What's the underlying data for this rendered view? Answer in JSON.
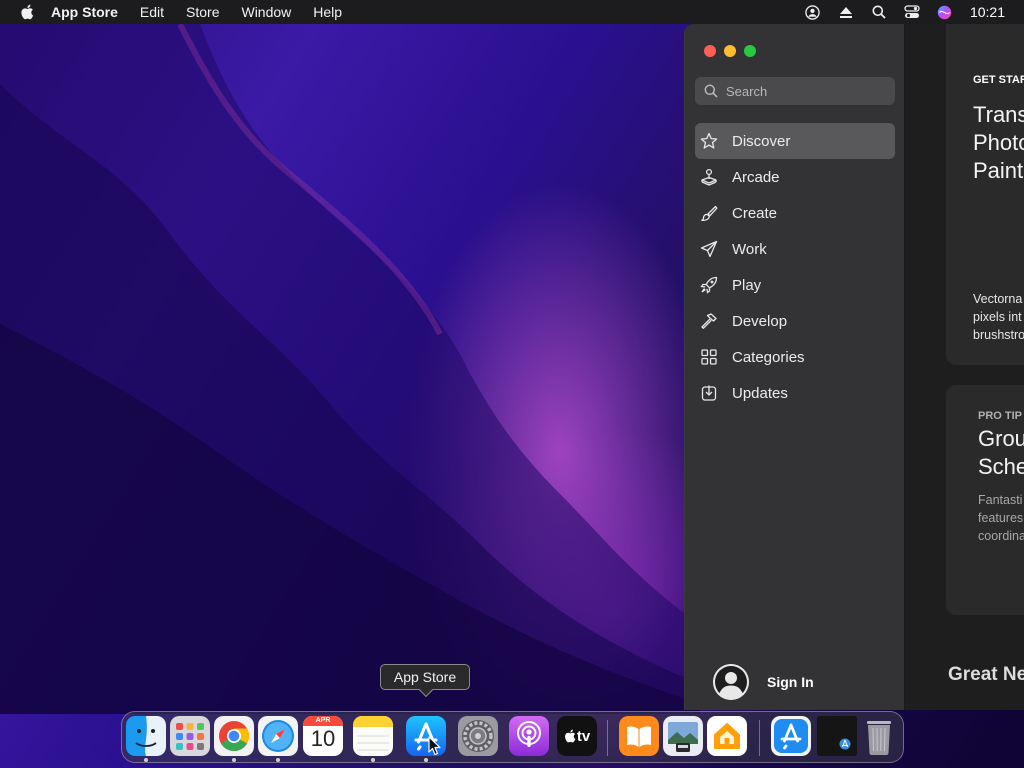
{
  "menubar": {
    "apple_icon": "apple-logo-icon",
    "app_name": "App Store",
    "menus": [
      "Edit",
      "Store",
      "Window",
      "Help"
    ],
    "status_icons": [
      "user-account-icon",
      "eject-icon",
      "spotlight-search-icon",
      "control-center-icon",
      "siri-icon"
    ],
    "clock": "10:21"
  },
  "window": {
    "search": {
      "placeholder": "Search"
    },
    "sidebar_items": [
      {
        "label": "Discover",
        "icon": "star-icon",
        "active": true
      },
      {
        "label": "Arcade",
        "icon": "joystick-icon"
      },
      {
        "label": "Create",
        "icon": "brush-icon"
      },
      {
        "label": "Work",
        "icon": "paper-plane-icon"
      },
      {
        "label": "Play",
        "icon": "rocket-icon"
      },
      {
        "label": "Develop",
        "icon": "hammer-icon"
      },
      {
        "label": "Categories",
        "icon": "grid-icon"
      },
      {
        "label": "Updates",
        "icon": "download-tray-icon"
      }
    ],
    "sign_in": "Sign In",
    "cards": [
      {
        "eyebrow": "GET STAR",
        "headline": "Trans\nPhoto\nPaint",
        "description": "Vectorna\npixels int\nbrushstro"
      },
      {
        "eyebrow": "PRO TIP",
        "headline": "Grou\nSche",
        "description": "Fantasti\nfeatures\ncoordina"
      }
    ],
    "section_title": "Great Ne"
  },
  "tooltip": "App Store",
  "dock": {
    "apps": [
      {
        "name": "finder-icon",
        "running": true
      },
      {
        "name": "launchpad-icon",
        "running": false
      },
      {
        "name": "chrome-icon",
        "running": true
      },
      {
        "name": "safari-icon",
        "running": true
      },
      {
        "name": "calendar-icon",
        "running": false,
        "month": "APR",
        "day": "10"
      },
      {
        "name": "notes-icon",
        "running": true
      },
      {
        "name": "app-store-icon",
        "running": true
      },
      {
        "name": "system-preferences-icon",
        "running": false
      },
      {
        "name": "podcasts-icon",
        "running": false
      },
      {
        "name": "apple-tv-icon",
        "running": false,
        "label": "tv"
      },
      {
        "name": "books-icon",
        "running": false
      },
      {
        "name": "preview-icon",
        "running": false
      },
      {
        "name": "home-icon",
        "running": false
      },
      {
        "name": "app-store-download-icon",
        "running": false
      },
      {
        "name": "minimized-window-icon",
        "running": false
      },
      {
        "name": "trash-icon",
        "running": false
      }
    ]
  },
  "colors": {
    "accent": "#0a84ff",
    "close": "#ff5f57",
    "minimize": "#febc2e",
    "zoom": "#28c840",
    "eyebrow_blue": "#ffffff",
    "eyebrow_gray": "#b0b0b0"
  }
}
